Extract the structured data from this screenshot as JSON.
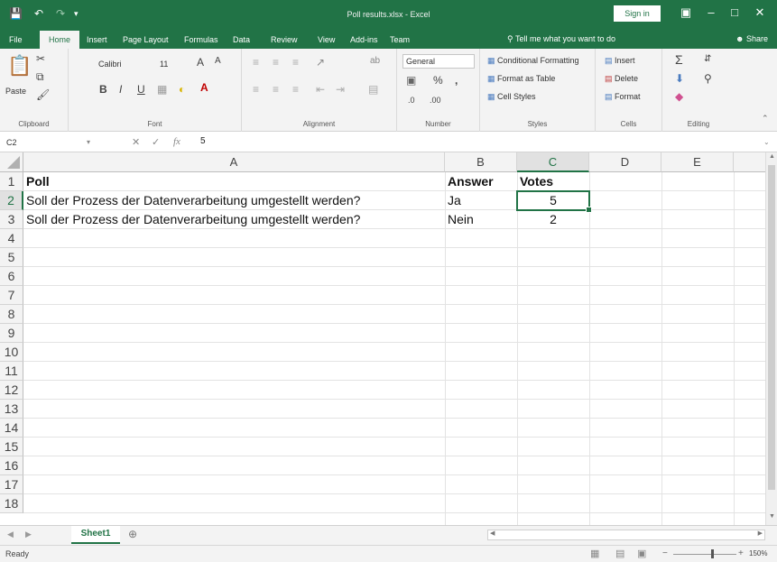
{
  "title_bar": {
    "title": "Poll results.xlsx  -  Excel",
    "sign_in": "Sign in",
    "save_icon": "save-icon",
    "undo_icon": "undo-icon",
    "redo_icon": "redo-icon"
  },
  "tabs": [
    "File",
    "Home",
    "Insert",
    "Page Layout",
    "Formulas",
    "Data",
    "Review",
    "View",
    "Add-ins",
    "Team"
  ],
  "active_tab": "Home",
  "tell_me": "Tell me what you want to do",
  "share": "Share",
  "ribbon": {
    "clipboard": {
      "paste": "Paste",
      "label": "Clipboard"
    },
    "font": {
      "name": "Calibri",
      "size": "11",
      "label": "Font"
    },
    "alignment": {
      "label": "Alignment"
    },
    "number": {
      "format": "General",
      "label": "Number"
    },
    "styles": {
      "conditional": "Conditional Formatting",
      "format_table": "Format as Table",
      "cell_styles": "Cell Styles",
      "label": "Styles"
    },
    "cells": {
      "insert": "Insert",
      "delete": "Delete",
      "format": "Format",
      "label": "Cells"
    },
    "editing": {
      "label": "Editing"
    }
  },
  "formula_bar": {
    "name_box": "C2",
    "fx": "fx",
    "value": "5"
  },
  "columns": [
    "A",
    "B",
    "C",
    "D",
    "E"
  ],
  "selected_column": "C",
  "selected_row": "2",
  "rows": [
    "1",
    "2",
    "3",
    "4",
    "5",
    "6",
    "7",
    "8",
    "9",
    "10",
    "11",
    "12",
    "13",
    "14",
    "15",
    "16",
    "17",
    "18"
  ],
  "cells": {
    "A1": "Poll",
    "B1": "Answer",
    "C1": "Votes",
    "A2": "Soll der Prozess der Datenverarbeitung umgestellt werden?",
    "B2": "Ja",
    "C2": "5",
    "A3": "Soll der Prozess der Datenverarbeitung umgestellt werden?",
    "B3": "Nein",
    "C3": "2"
  },
  "sheet_tab": "Sheet1",
  "status": "Ready",
  "zoom": "150%",
  "colors": {
    "excel_green": "#217346"
  }
}
